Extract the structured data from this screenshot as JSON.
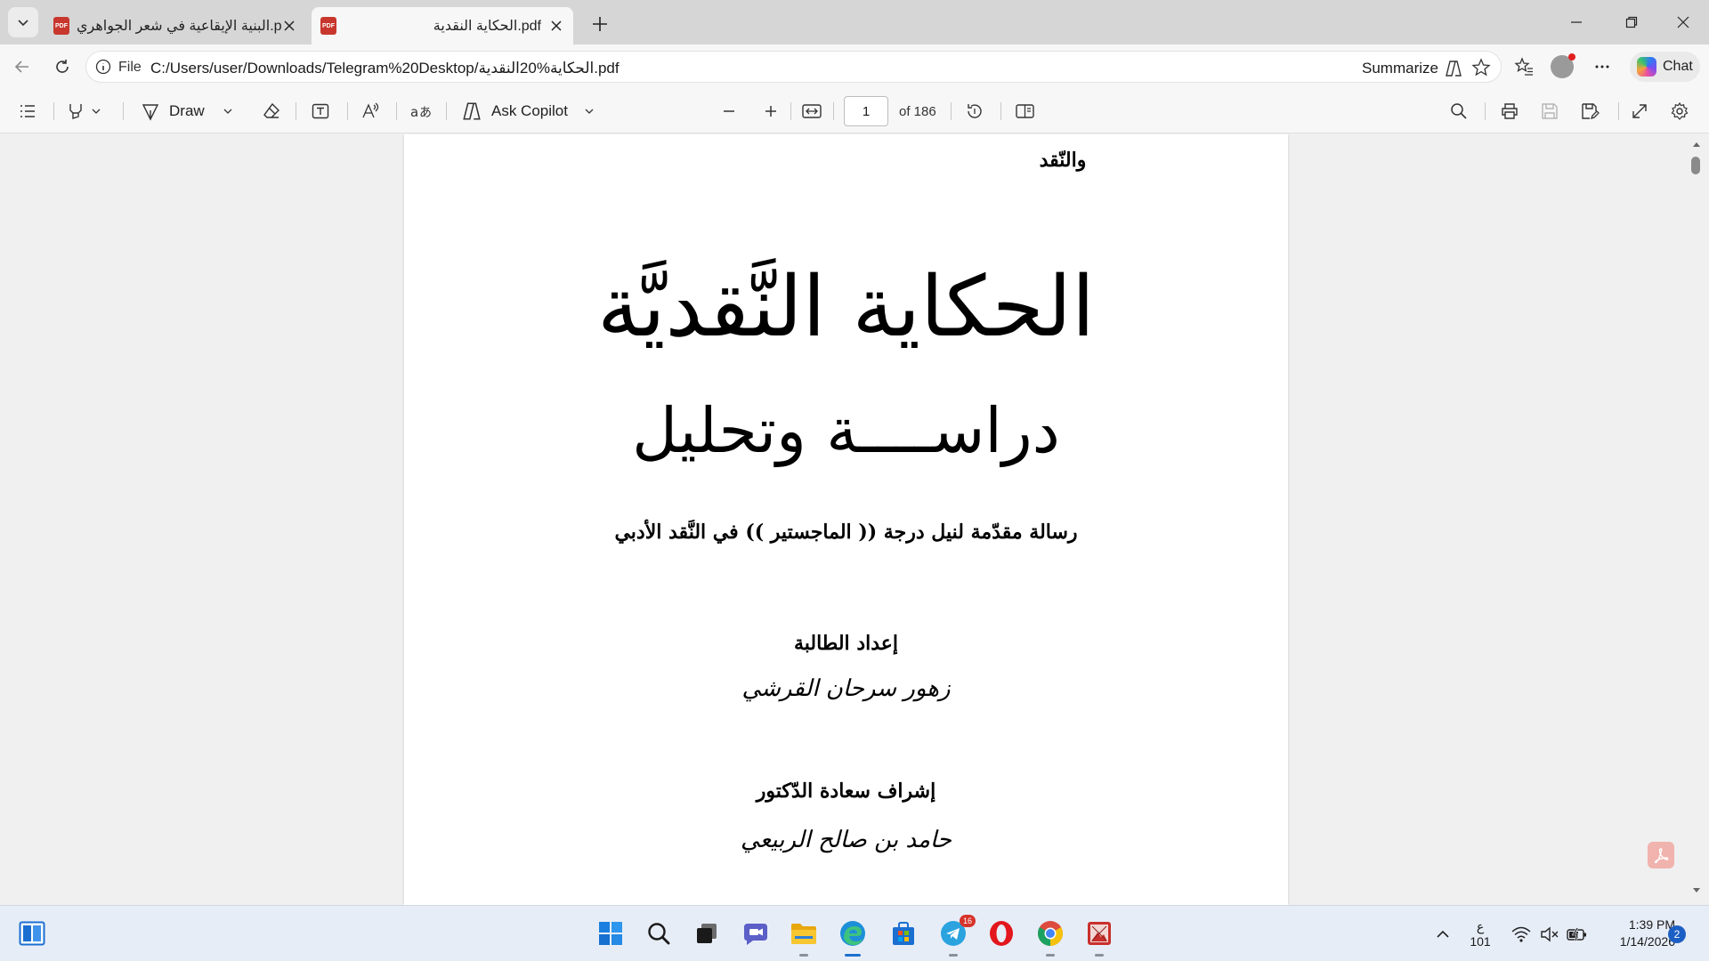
{
  "browser": {
    "tabs": [
      {
        "title": "البنية الإيقاعية في شعر الجواهري.pdf",
        "active": false
      },
      {
        "title": "الحكاية النقدية.pdf",
        "active": true
      }
    ],
    "address": {
      "scheme_label": "File",
      "url": "C:/Users/user/Downloads/Telegram%20Desktop/الحكاية%20النقدية.pdf"
    },
    "summarize_label": "Summarize",
    "chat_label": "Chat"
  },
  "pdf_toolbar": {
    "draw_label": "Draw",
    "ask_copilot_label": "Ask Copilot",
    "page_current": "1",
    "page_total": "of 186"
  },
  "document": {
    "header_line": "والنّقد",
    "title": "الحكاية النَّقديَّة",
    "subtitle": "دراســــة وتحليل",
    "degree_line": "رسالة مقدّمة لنيل درجة (( الماجستير )) في النَّقد الأدبي",
    "prepared_label": "إعداد الطالبة",
    "student_name": "زهور سرحان القرشي",
    "supervisor_label": "إشراف سعادة الدّكتور",
    "supervisor_name": "حامد بن صالح الربيعي"
  },
  "taskbar": {
    "telegram_badge": "16",
    "lang_top": "ع",
    "lang_bottom": "101",
    "time": "1:39 PM",
    "date": "1/14/2026",
    "notifications": "2"
  },
  "colors": {
    "tabstrip_bg": "#d6d6d6",
    "toolbar_bg": "#f7f7f7",
    "viewer_bg": "#f0f0f0",
    "taskbar_bg": "#e7edf7",
    "pdf_red": "#c8372d"
  }
}
